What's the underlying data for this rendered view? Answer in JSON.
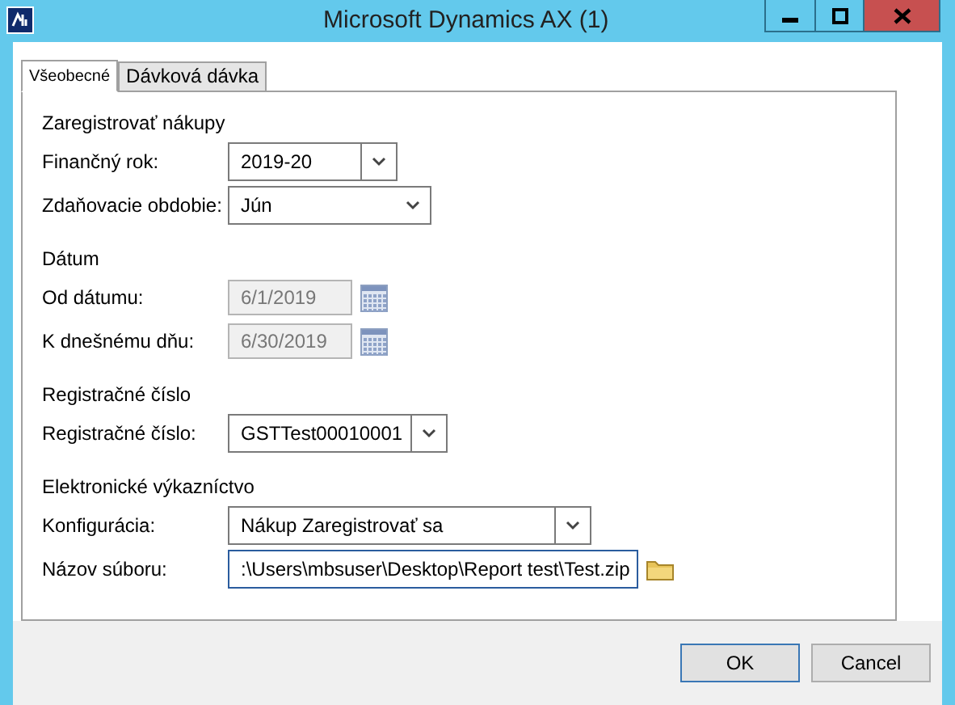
{
  "window": {
    "title": "Microsoft Dynamics AX (1)"
  },
  "tabs": [
    {
      "label": "Všeobecné",
      "selected": true
    },
    {
      "label": "Dávková dávka",
      "selected": false
    }
  ],
  "groups": [
    {
      "title": "Zaregistrovať nákupy",
      "fields": [
        {
          "label": "Finančný rok:",
          "kind": "combo",
          "value": "2019-20"
        },
        {
          "label": "Zdaňovacie obdobie:",
          "kind": "select",
          "value": "Jún"
        }
      ]
    },
    {
      "title": "Dátum",
      "fields": [
        {
          "label": "Od dátumu:",
          "kind": "date",
          "value": "6/1/2019",
          "disabled": true
        },
        {
          "label": "K dnešnému dňu:",
          "kind": "date",
          "value": "6/30/2019",
          "disabled": true
        }
      ]
    },
    {
      "title": "Registračné číslo",
      "fields": [
        {
          "label": "Registračné číslo:",
          "kind": "combo",
          "value": "GSTTest00010001"
        }
      ]
    },
    {
      "title": "Elektronické výkazníctvo",
      "fields": [
        {
          "label": "Konfigurácia:",
          "kind": "combo",
          "value": "Nákup Zaregistrovať sa"
        },
        {
          "label": "Názov súboru:",
          "kind": "file",
          "value": ":\\Users\\mbsuser\\Desktop\\Report test\\Test.zip",
          "focused": true
        }
      ]
    }
  ],
  "buttons": [
    {
      "label": "OK",
      "default": true
    },
    {
      "label": "Cancel",
      "default": false
    }
  ]
}
